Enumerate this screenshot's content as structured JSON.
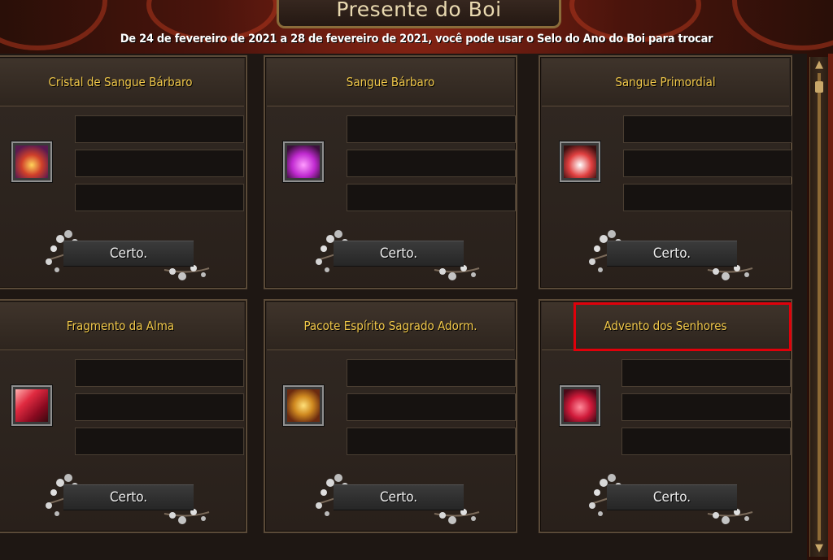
{
  "window": {
    "title": "Presente do Boi",
    "subtitle": "De 24 de fevereiro de 2021 a 28 de fevereiro de 2021, você pode usar o Selo do Ano do Boi para trocar"
  },
  "cards": [
    {
      "title": "Cristal de Sangue Bárbaro",
      "button": "Certo.",
      "icon": "blood-crystal-bottle-icon",
      "highlighted": false
    },
    {
      "title": "Sangue Bárbaro",
      "button": "Certo.",
      "icon": "purple-potion-icon",
      "highlighted": false
    },
    {
      "title": "Sangue Primordial",
      "button": "Certo.",
      "icon": "red-potion-icon",
      "highlighted": false
    },
    {
      "title": "Fragmento da Alma",
      "button": "Certo.",
      "icon": "red-gem-icon",
      "highlighted": false
    },
    {
      "title": "Pacote Espírito Sagrado Adorm.",
      "button": "Certo.",
      "icon": "treasure-chest-icon",
      "highlighted": false
    },
    {
      "title": "Advento dos Senhores",
      "button": "Certo.",
      "icon": "red-pouch-icon",
      "highlighted": true
    }
  ],
  "colors": {
    "card_title": "#f2c94a",
    "highlight": "#e0000a",
    "frame_red": "#8a2414"
  }
}
